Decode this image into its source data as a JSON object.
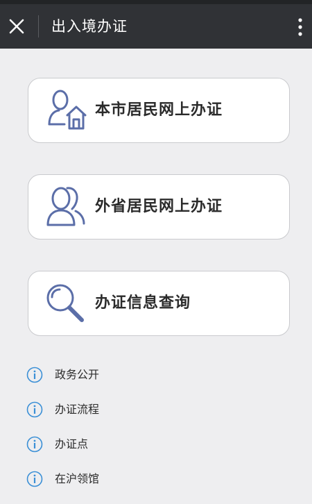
{
  "header": {
    "title": "出入境办证",
    "close_icon": "close-icon",
    "more_icon": "more-vertical-icon"
  },
  "colors": {
    "header_bg": "#303236",
    "page_bg": "#eeeef0",
    "icon_blue": "#5b6ea8",
    "info_blue": "#3a8fd6"
  },
  "cards": [
    {
      "label": "本市居民网上办证",
      "icon": "resident-home-icon"
    },
    {
      "label": "外省居民网上办证",
      "icon": "users-icon"
    },
    {
      "label": "办证信息查询",
      "icon": "search-icon"
    }
  ],
  "links": [
    {
      "label": "政务公开",
      "icon": "info-icon"
    },
    {
      "label": "办证流程",
      "icon": "info-icon"
    },
    {
      "label": "办证点",
      "icon": "info-icon"
    },
    {
      "label": "在沪领馆",
      "icon": "info-icon"
    }
  ]
}
